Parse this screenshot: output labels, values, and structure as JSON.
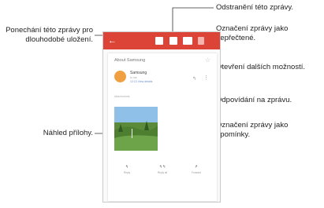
{
  "callouts": {
    "keep": "Ponechání této zprávy pro dlouhodobé uložení.",
    "delete": "Odstranění této zprávy.",
    "mark_unread": "Označení zprávy jako nepřečtené.",
    "more": "Otevření dalších možností.",
    "reply": "Odpovídání na zprávu.",
    "reminder": "Označení zprávy jako upomínky.",
    "preview": "Náhled přílohy."
  },
  "email": {
    "back_glyph": "←",
    "subject": "About Samsung",
    "star_glyph": "☆",
    "sender": "Samsung",
    "to_line": "to me",
    "date_line": "12:13  View details",
    "reply_glyph": "↰",
    "more_glyph": "⋮",
    "attachments_label": "Attachments"
  },
  "actions": [
    {
      "glyph": "↰",
      "label": "Reply"
    },
    {
      "glyph": "↰↰",
      "label": "Reply all"
    },
    {
      "glyph": "↱",
      "label": "Forward"
    }
  ],
  "colors": {
    "appbar": "#db4437",
    "avatar": "#f0a040"
  },
  "icons": {
    "keep": "archive-icon",
    "delete": "trash-icon",
    "mark_unread": "mail-icon",
    "more": "more-vert-icon",
    "reply": "reply-icon",
    "reminder": "star-icon"
  }
}
